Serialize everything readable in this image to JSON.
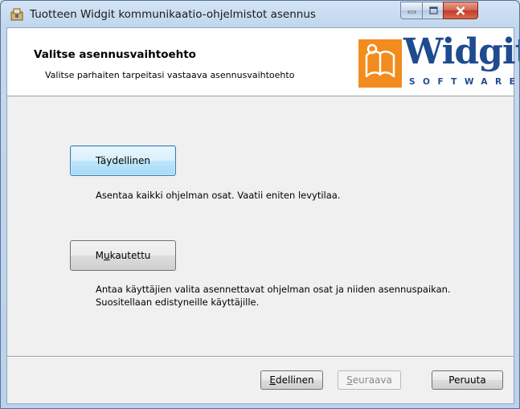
{
  "window": {
    "title": "Tuotteen Widgit kommunikaatio-ohjelmistot asennus",
    "icon": "installer-icon",
    "controls": {
      "minimize": "minimize-icon",
      "maximize": "maximize-icon",
      "close": "close-icon"
    }
  },
  "banner": {
    "title": "Valitse asennusvaihtoehto",
    "subtitle": "Valitse parhaiten tarpeitasi vastaava asennusvaihtoehto",
    "logo_text": "Widgit",
    "logo_subtext": "SOFTWARE",
    "logo_color": "#1f4b8f",
    "logo_accent": "#f28c1e"
  },
  "options": {
    "complete": {
      "label_before": "Täydellinen",
      "description": "Asentaa kaikki ohjelman osat. Vaatii eniten levytilaa."
    },
    "custom": {
      "label_before": "M",
      "label_underlined": "u",
      "label_after": "kautettu",
      "description_line1": "Antaa käyttäjien valita asennettavat ohjelman osat ja niiden asennuspaikan.",
      "description_line2": "Suositellaan edistyneille käyttäjille."
    }
  },
  "footer": {
    "back": {
      "underlined": "E",
      "rest": "dellinen"
    },
    "next": {
      "underlined": "S",
      "rest": "euraava",
      "enabled": false
    },
    "cancel": "Peruuta"
  }
}
